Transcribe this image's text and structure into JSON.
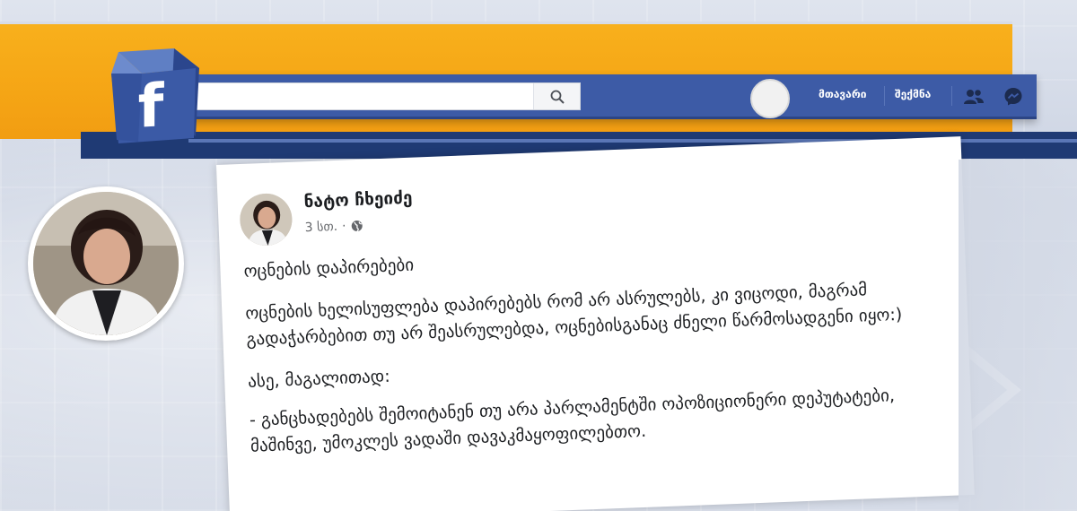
{
  "toolbar": {
    "search_placeholder": "",
    "nav_home": "მთავარი",
    "nav_create": "შექმნა",
    "icons": [
      "search-icon",
      "friends-icon",
      "messenger-icon"
    ]
  },
  "logo": {
    "letter": "f"
  },
  "post": {
    "author": "ნატო ჩხეიძე",
    "time": "3 სთ.",
    "privacy_icon": "globe-icon",
    "menu_icon": "more-dots-icon",
    "paragraphs": [
      "ოცნების დაპირებები",
      "ოცნების ხელისუფლება  დაპირებებს რომ არ ასრულებს, კი ვიცოდი, მაგრამ გადაჭარბებით  თუ არ შეასრულებდა, ოცნებისგანაც ძნელი წარმოსადგენი იყო:)",
      "ასე, მაგალითად:",
      "- განცხადებებს შემოიტანენ თუ არა პარლამენტში ოპოზიციონერი დეპუტატები, მაშინვე, უმოკლეს  ვადაში დავაკმაყოფილებთო."
    ]
  },
  "colors": {
    "facebook_blue": "#3d5ba6",
    "banner_orange": "#f5a515",
    "dark_blue_band": "#1f3a74"
  }
}
